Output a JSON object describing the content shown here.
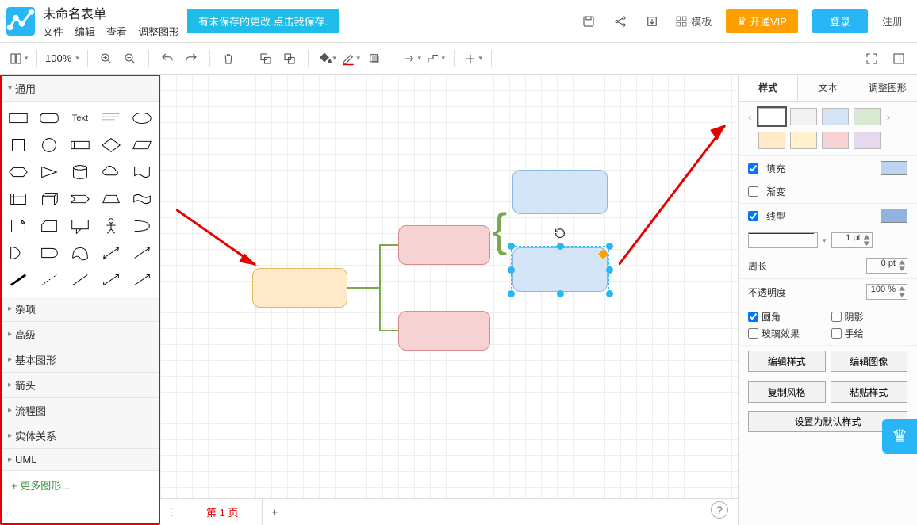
{
  "header": {
    "title": "未命名表单",
    "menus": [
      "文件",
      "编辑",
      "查看",
      "调整图形"
    ],
    "unsaved_notice": "有未保存的更改.点击我保存.",
    "template_label": "模板",
    "vip_label": "开通VIP",
    "login_label": "登录",
    "register_label": "注册"
  },
  "toolbar": {
    "zoom": "100%"
  },
  "sidebar": {
    "sections": {
      "general": "通用",
      "misc": "杂项",
      "advanced": "高级",
      "basic_shapes": "基本图形",
      "arrows": "箭头",
      "flowchart": "流程图",
      "entity_relation": "实体关系",
      "uml": "UML"
    },
    "text_shape": "Text",
    "more_shapes": "+ 更多图形..."
  },
  "tabs": {
    "page1": "第 1 页"
  },
  "right": {
    "tabs": {
      "style": "样式",
      "text": "文本",
      "adjust": "调整图形"
    },
    "fill": "填充",
    "gradient": "渐变",
    "line": "线型",
    "line_width": "1 pt",
    "perimeter": "周长",
    "perimeter_val": "0 pt",
    "opacity_label": "不透明度",
    "opacity_val": "100 %",
    "rounded": "圆角",
    "shadow": "阴影",
    "glass": "玻璃效果",
    "hand": "手绘",
    "edit_style": "编辑样式",
    "edit_image": "编辑图像",
    "copy_style": "复制风格",
    "paste_style": "粘贴样式",
    "set_default": "设置为默认样式"
  },
  "swatches": {
    "row1": [
      "#ffffff",
      "#f2f2f2",
      "#d5e5f8",
      "#d9ead3"
    ],
    "row2": [
      "#ffe9c8",
      "#fff2cc",
      "#f6d2d2",
      "#e6d9ef"
    ]
  }
}
